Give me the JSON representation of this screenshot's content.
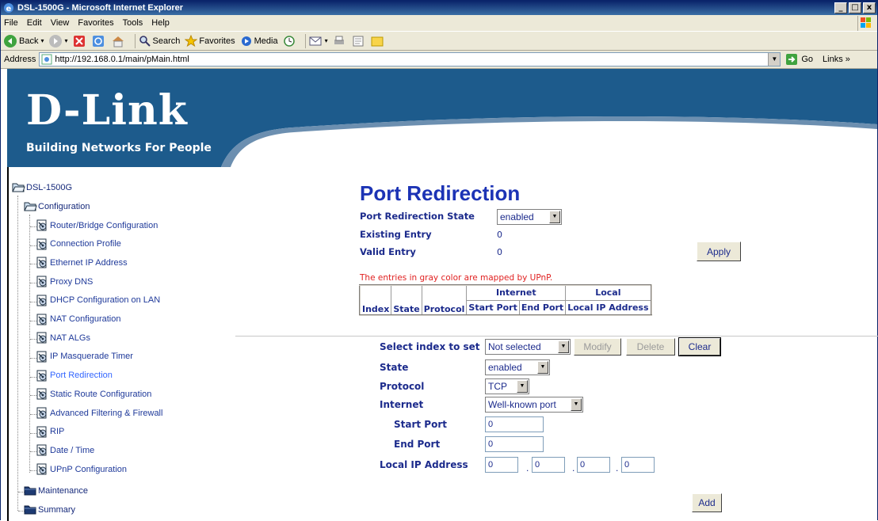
{
  "window": {
    "title": "DSL-1500G - Microsoft Internet Explorer",
    "controls": [
      "_",
      "□",
      "x"
    ]
  },
  "menu": [
    "File",
    "Edit",
    "View",
    "Favorites",
    "Tools",
    "Help"
  ],
  "toolbar": {
    "back": "Back",
    "search": "Search",
    "favorites": "Favorites",
    "media": "Media"
  },
  "address": {
    "label": "Address",
    "url": "http://192.168.0.1/main/pMain.html",
    "go": "Go",
    "links": "Links"
  },
  "brand": {
    "logo": "D-Link",
    "tagline": "Building Networks For People"
  },
  "colors": {
    "banner": "#1d5b8c",
    "heading": "#1c33b5",
    "link": "#1f3a9a",
    "active": "#3366ff",
    "note": "#e02020"
  },
  "tree": {
    "root": "DSL-1500G",
    "configuration": "Configuration",
    "items": [
      "Router/Bridge Configuration",
      "Connection Profile",
      "Ethernet IP Address",
      "Proxy DNS",
      "DHCP Configuration on LAN",
      "NAT Configuration",
      "NAT ALGs",
      "IP Masquerade Timer",
      "Port Redirection",
      "Static Route Configuration",
      "Advanced Filtering & Firewall",
      "RIP",
      "Date / Time",
      "UPnP Configuration"
    ],
    "maintenance": "Maintenance",
    "summary": "Summary"
  },
  "page": {
    "title": "Port Redirection",
    "state_label": "Port Redirection State",
    "state_value": "enabled",
    "existing_label": "Existing Entry",
    "existing_value": "0",
    "valid_label": "Valid Entry",
    "valid_value": "0",
    "apply": "Apply",
    "note": "The entries in gray color are mapped by UPnP.",
    "table": {
      "group_internet": "Internet",
      "group_local": "Local",
      "headers": [
        "Index",
        "State",
        "Protocol",
        "Start Port",
        "End Port",
        "Local IP Address"
      ]
    },
    "form": {
      "select_index_label": "Select index to set",
      "select_index_value": "Not selected",
      "modify": "Modify",
      "delete": "Delete",
      "clear": "Clear",
      "state_label": "State",
      "state_value": "enabled",
      "protocol_label": "Protocol",
      "protocol_value": "TCP",
      "internet_label": "Internet",
      "internet_value": "Well-known port",
      "start_label": "Start Port",
      "start_value": "0",
      "end_label": "End Port",
      "end_value": "0",
      "ip_label": "Local IP Address",
      "ip": [
        "0",
        "0",
        "0",
        "0"
      ],
      "ip_sep": ".",
      "add": "Add"
    }
  }
}
